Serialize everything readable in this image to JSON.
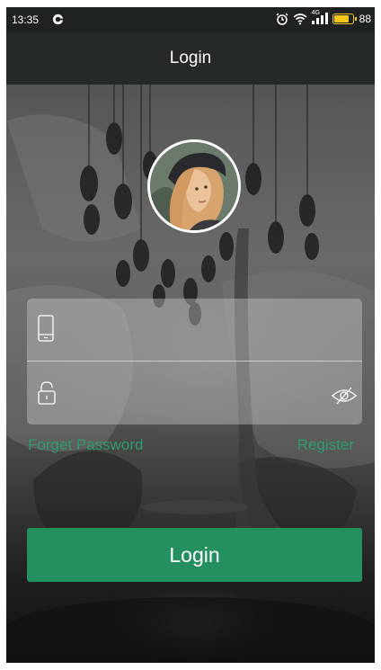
{
  "status_bar": {
    "time": "13:35",
    "network_label": "4G",
    "battery_level": 88,
    "battery_text": "88",
    "icons": [
      "app-notification-icon",
      "alarm-icon",
      "wifi-icon",
      "signal-icon",
      "battery-icon"
    ]
  },
  "header": {
    "title": "Login"
  },
  "form": {
    "phone_field": {
      "value": "",
      "placeholder": "",
      "icon": "phone-icon"
    },
    "password_field": {
      "value": "",
      "placeholder": "",
      "icon": "lock-icon",
      "toggle_icon": "eye-off-icon"
    }
  },
  "links": {
    "forget_password": "Forget Password",
    "register": "Register"
  },
  "login_button": {
    "label": "Login"
  },
  "colors": {
    "accent": "#24905f",
    "link": "#2d9c6c",
    "header_bg": "#25292a",
    "battery": "#f5c518"
  }
}
